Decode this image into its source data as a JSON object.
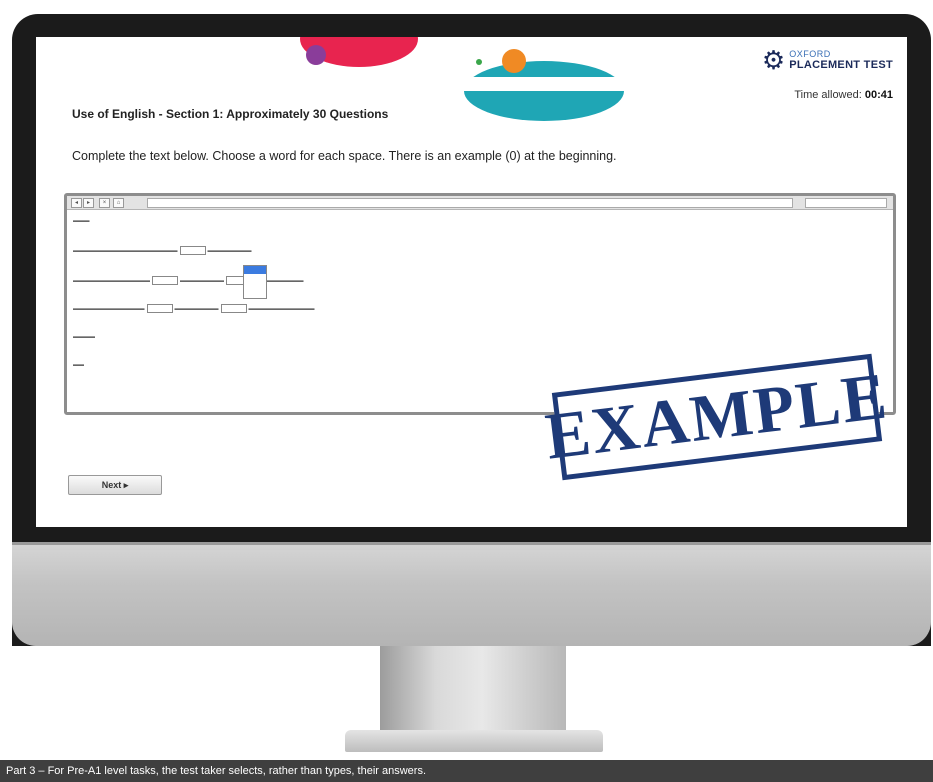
{
  "logo": {
    "top": "OXFORD",
    "bottom": "PLACEMENT TEST",
    "icon": "gear-icon"
  },
  "timer": {
    "label": "Time allowed:",
    "value": "00:41"
  },
  "section_title": "Use of English - Section 1: Approximately 30 Questions",
  "instruction": "Complete the text below. Choose a word for each space. There is an example (0) at the beginning.",
  "next_button": "Next ▸",
  "stamp": "EXAMPLE",
  "caption": "Part 3 – For Pre-A1 level tasks, the test taker selects, rather than types, their answers.",
  "colors": {
    "stamp": "#1e3a78",
    "frame": "#1b1b1b",
    "caption_bg": "#3f3f3f"
  }
}
